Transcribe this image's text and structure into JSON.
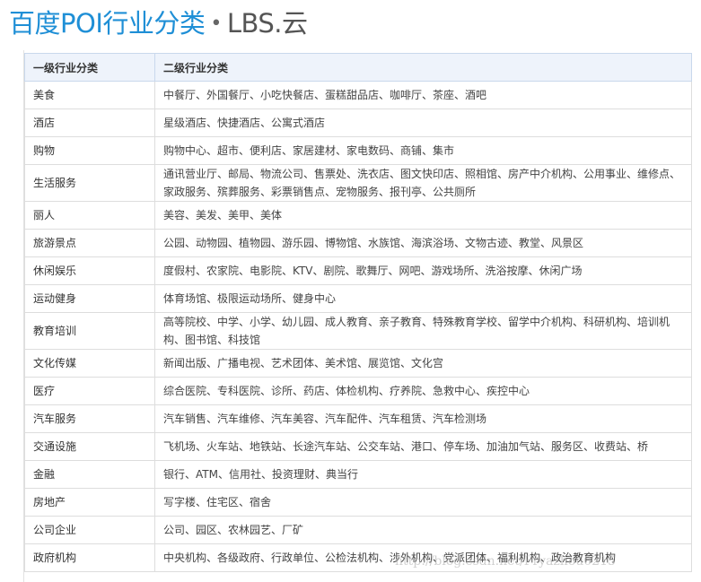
{
  "title": {
    "main": "百度POI行业分类",
    "separator": "•",
    "sub": "LBS.云"
  },
  "table": {
    "headers": [
      "一级行业分类",
      "二级行业分类"
    ],
    "rows": [
      {
        "category": "美食",
        "subcategories": "中餐厅、外国餐厅、小吃快餐店、蛋糕甜品店、咖啡厅、茶座、酒吧"
      },
      {
        "category": "酒店",
        "subcategories": "星级酒店、快捷酒店、公寓式酒店"
      },
      {
        "category": "购物",
        "subcategories": "购物中心、超市、便利店、家居建材、家电数码、商铺、集市"
      },
      {
        "category": "生活服务",
        "subcategories": "通讯营业厅、邮局、物流公司、售票处、洗衣店、图文快印店、照相馆、房产中介机构、公用事业、维修点、家政服务、殡葬服务、彩票销售点、宠物服务、报刊亭、公共厕所"
      },
      {
        "category": "丽人",
        "subcategories": "美容、美发、美甲、美体"
      },
      {
        "category": "旅游景点",
        "subcategories": "公园、动物园、植物园、游乐园、博物馆、水族馆、海滨浴场、文物古迹、教堂、风景区"
      },
      {
        "category": "休闲娱乐",
        "subcategories": "度假村、农家院、电影院、KTV、剧院、歌舞厅、网吧、游戏场所、洗浴按摩、休闲广场"
      },
      {
        "category": "运动健身",
        "subcategories": "体育场馆、极限运动场所、健身中心"
      },
      {
        "category": "教育培训",
        "subcategories": "高等院校、中学、小学、幼儿园、成人教育、亲子教育、特殊教育学校、留学中介机构、科研机构、培训机构、图书馆、科技馆"
      },
      {
        "category": "文化传媒",
        "subcategories": "新闻出版、广播电视、艺术团体、美术馆、展览馆、文化宫"
      },
      {
        "category": "医疗",
        "subcategories": "综合医院、专科医院、诊所、药店、体检机构、疗养院、急救中心、疾控中心"
      },
      {
        "category": "汽车服务",
        "subcategories": "汽车销售、汽车维修、汽车美容、汽车配件、汽车租赁、汽车检测场"
      },
      {
        "category": "交通设施",
        "subcategories": "飞机场、火车站、地铁站、长途汽车站、公交车站、港口、停车场、加油加气站、服务区、收费站、桥"
      },
      {
        "category": "金融",
        "subcategories": "银行、ATM、信用社、投资理财、典当行"
      },
      {
        "category": "房地产",
        "subcategories": "写字楼、住宅区、宿舍"
      },
      {
        "category": "公司企业",
        "subcategories": "公司、园区、农林园艺、厂矿"
      },
      {
        "category": "政府机构",
        "subcategories": "中央机构、各级政府、行政单位、公检法机构、涉外机构、党派团体、福利机构、政治教育机构"
      }
    ]
  },
  "watermark": "http://blog.csdn.net/Fryazhou0215"
}
